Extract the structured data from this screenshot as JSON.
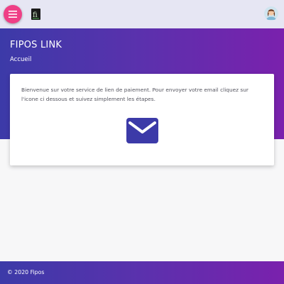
{
  "header": {
    "menu_icon": "hamburger-icon",
    "logo_icon": "fipos-logo-icon",
    "logo_text": "fi",
    "avatar_icon": "user-avatar-icon",
    "menu_button_color": "#ef3f86"
  },
  "hero": {
    "title": "FIPOS LINK",
    "breadcrumb": "Accueil",
    "gradient_start": "#3c3aa8",
    "gradient_end": "#7a21ad"
  },
  "card": {
    "intro_text": "Bienvenue sur votre service de lien de paiement. Pour envoyer votre email cliquez sur l'icone ci dessous et suivez simplement les étapes.",
    "action_icon": "mail-icon",
    "icon_color": "#3c3aa8"
  },
  "footer": {
    "text": "© 2020 Fipos"
  }
}
